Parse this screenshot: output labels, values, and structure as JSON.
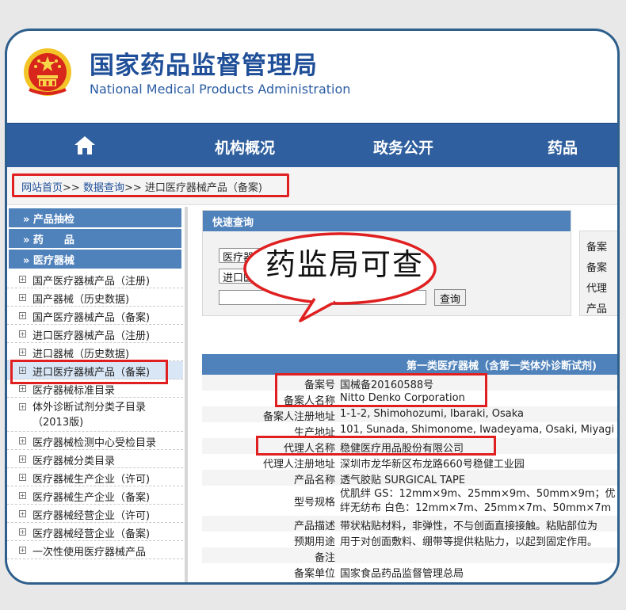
{
  "header": {
    "title_cn": "国家药品监督管理局",
    "title_en": "National Medical Products Administration"
  },
  "nav": {
    "items": [
      "机构概况",
      "政务公开",
      "药品"
    ]
  },
  "breadcrumb": {
    "home": "网站首页",
    "sep": ">>",
    "query": "数据查询",
    "current": "进口医疗器械产品（备案)"
  },
  "sidebar": {
    "heads": [
      "» 产品抽检",
      "» 药　　品",
      "» 医疗器械"
    ],
    "items": [
      "国产医疗器械产品（注册)",
      "国产器械（历史数据)",
      "国产医疗器械产品（备案)",
      "进口医疗器械产品（注册)",
      "进口器械（历史数据)",
      "进口医疗器械产品（备案)",
      "医疗器械标准目录",
      "体外诊断试剂分类子目录（2013版)",
      "医疗器械检测中心受检目录",
      "医疗器械分类目录",
      "医疗器械生产企业（许可)",
      "医疗器械生产企业（备案)",
      "医疗器械经营企业（许可)",
      "医疗器械经营企业（备案)",
      "一次性使用医疗器械产品"
    ]
  },
  "quick_search": {
    "title": "快速查询",
    "category": "医疗器械",
    "dataset": "进口医疗器械产品（备案)",
    "search_button": "查询"
  },
  "right_panel": {
    "labels": [
      "备案",
      "备案",
      "代理",
      "产品"
    ]
  },
  "callout": {
    "text": "药监局可查"
  },
  "detail": {
    "title": "第一类医疗器械（含第一类体外诊断试剂)",
    "rows": [
      {
        "k": "备案号",
        "v": "国械备20160588号"
      },
      {
        "k": "备案人名称",
        "v": "Nitto Denko Corporation"
      },
      {
        "k": "备案人注册地址",
        "v": "1-1-2, Shimohozumi, Ibaraki, Osaka"
      },
      {
        "k": "生产地址",
        "v": "101, Sunada, Shimonome, Iwadeyama, Osaki, Miyagi"
      },
      {
        "k": "代理人名称",
        "v": "稳健医疗用品股份有限公司"
      },
      {
        "k": "代理人注册地址",
        "v": "深圳市龙华新区布龙路660号稳健工业园"
      },
      {
        "k": "产品名称",
        "v": "透气胶贴 SURGICAL TAPE"
      },
      {
        "k": "型号规格",
        "v": "优肌绊 GS：12mm×9m、25mm×9m、50mm×9m；优",
        "v2": "绊无纺布 白色：12mm×7m、25mm×7m、50mm×7m"
      },
      {
        "k": "产品描述",
        "v": "带状粘贴材料，非弹性，不与创面直接接触。粘贴部位为"
      },
      {
        "k": "预期用途",
        "v": "用于对创面敷料、绷带等提供粘贴力，以起到固定作用。"
      },
      {
        "k": "备注",
        "v": ""
      },
      {
        "k": "备案单位",
        "v": "国家食品药品监督管理总局"
      }
    ]
  },
  "colors": {
    "brand_blue": "#2f5f9e",
    "panel_blue": "#4f82bb",
    "highlight_red": "#e02020",
    "frame": "#2e5f8c"
  }
}
